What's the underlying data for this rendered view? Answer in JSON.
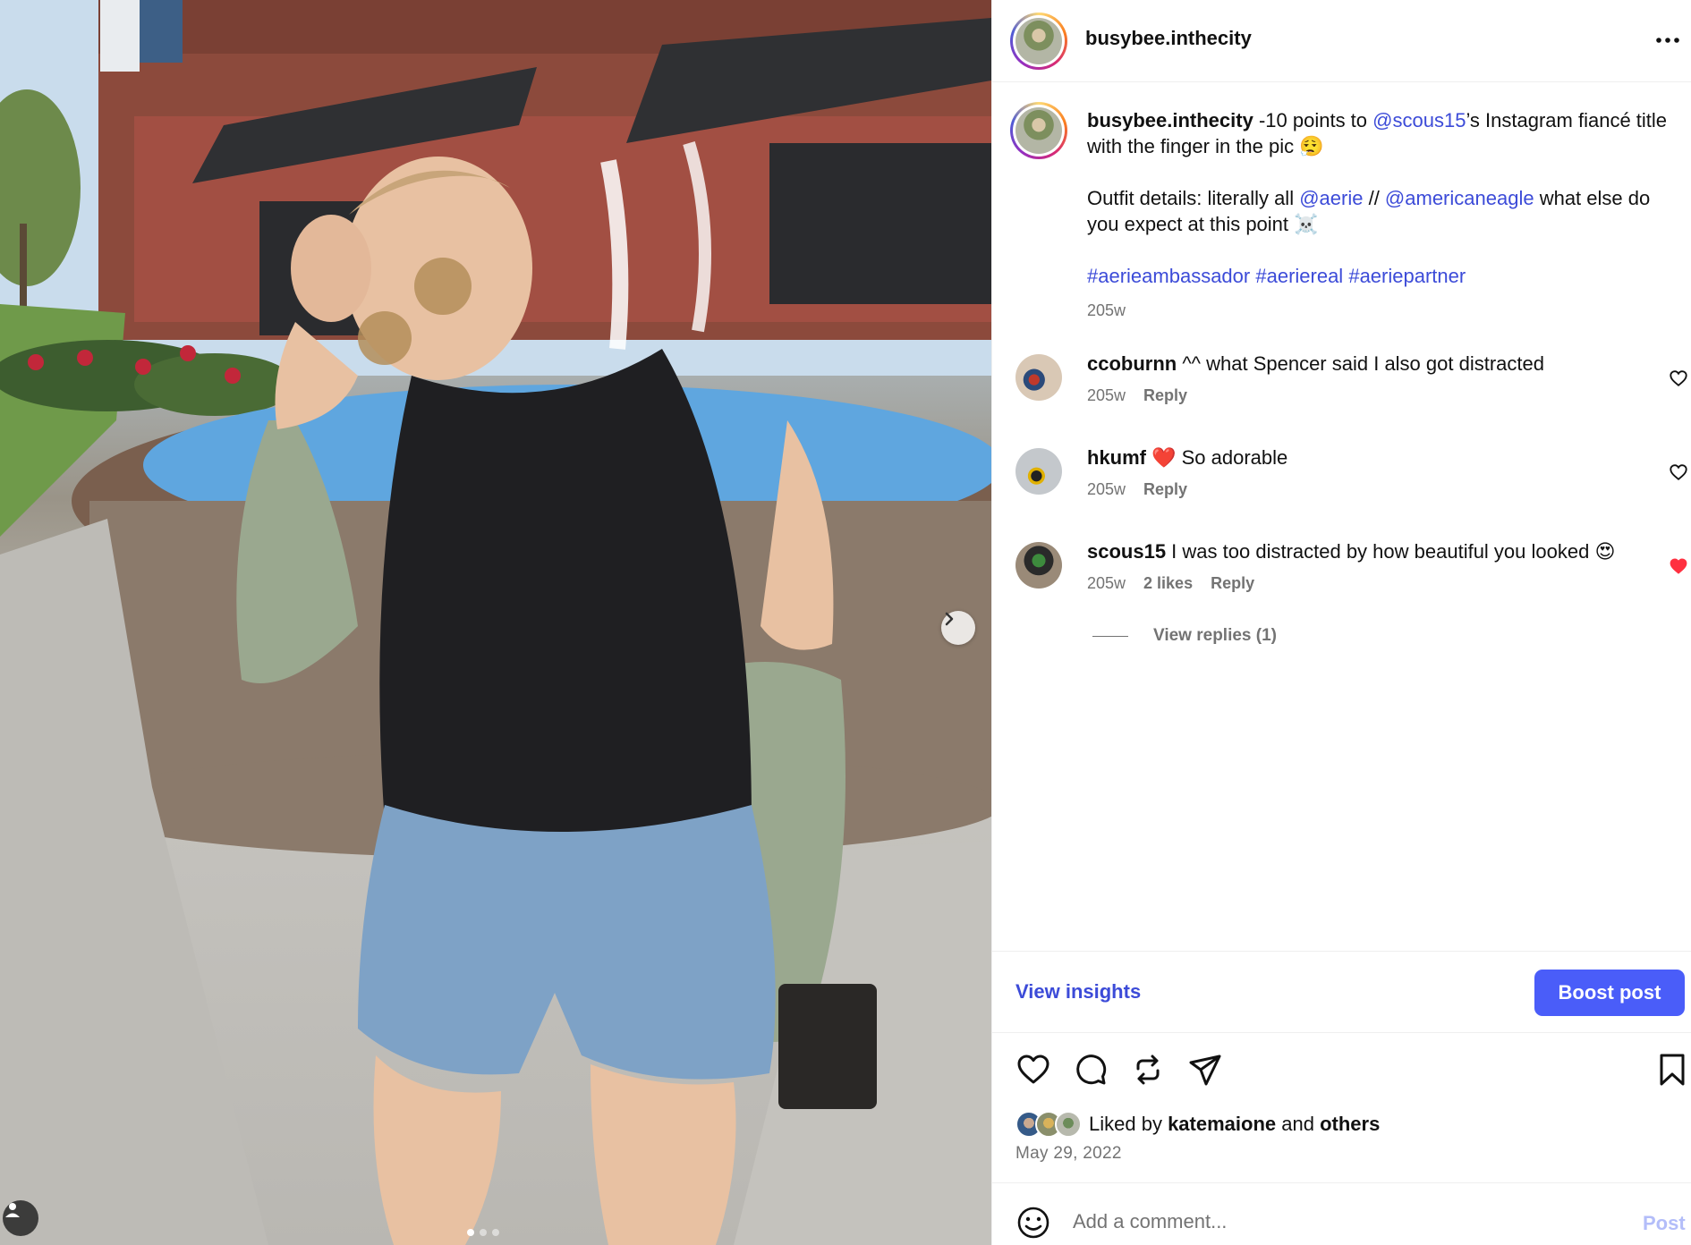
{
  "post": {
    "username": "busybee.inthecity",
    "caption": {
      "username": "busybee.inthecity",
      "line1_pre": " -10 points to ",
      "mention1": "@scous15",
      "line1_post": "’s Instagram fiancé title with the finger in the pic 😮‍💨",
      "line2_pre": "Outfit details: literally all ",
      "mention2": "@aerie",
      "line2_mid": " // ",
      "mention3": "@americaneagle",
      "line2_post": " what else do you expect at this point ☠️",
      "hashtag1": "#aerieambassador",
      "hashtag2": "#aeriereal",
      "hashtag3": "#aeriepartner",
      "age": "205w"
    },
    "comments": [
      {
        "username": "ccoburnn",
        "text": " ^^ what Spencer said I also got distracted",
        "age": "205w",
        "likes": "",
        "reply": "Reply",
        "liked": false
      },
      {
        "username": "hkumf",
        "text": " ❤️ So adorable",
        "age": "205w",
        "likes": "",
        "reply": "Reply",
        "liked": false
      },
      {
        "username": "scous15",
        "text": " I was too distracted by how beautiful you looked 😍",
        "age": "205w",
        "likes": "2 likes",
        "reply": "Reply",
        "liked": true
      }
    ],
    "view_replies": "View replies (1)",
    "view_insights": "View insights",
    "boost_post": "Boost post",
    "liked_by_prefix": "Liked by ",
    "liked_by_user": "katemaione",
    "liked_by_mid": " and ",
    "liked_by_others": "others",
    "date": "May 29, 2022",
    "comment_placeholder": "Add a comment...",
    "post_button": "Post"
  },
  "carousel": {
    "total": 3,
    "current": 1
  },
  "colors": {
    "link": "#3c4bd8",
    "boost": "#4a5df9",
    "like_red": "#ff3040",
    "muted": "#737373"
  },
  "icons": [
    "more-icon",
    "heart-icon",
    "comment-icon",
    "repost-icon",
    "share-icon",
    "bookmark-icon",
    "emoji-icon",
    "chevron-right-icon",
    "user-tag-icon"
  ]
}
